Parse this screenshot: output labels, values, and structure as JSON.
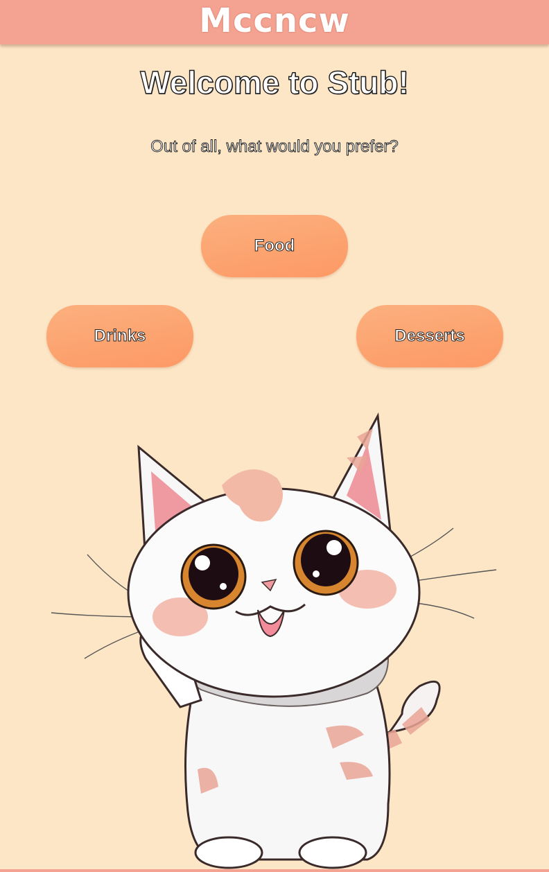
{
  "header": {
    "logo_text": "Mccncw"
  },
  "main": {
    "title": "Welcome to Stub!",
    "subtitle": "Out of all, what would you prefer?",
    "choices": [
      {
        "label": "Food"
      },
      {
        "label": "Drinks"
      },
      {
        "label": "Desserts"
      }
    ]
  },
  "colors": {
    "background": "#fde6c6",
    "header": "#f4a291",
    "button_gradient_start": "#fbb07e",
    "button_gradient_end": "#fd9965"
  },
  "illustration": {
    "name": "waving-kitten-illustration"
  }
}
